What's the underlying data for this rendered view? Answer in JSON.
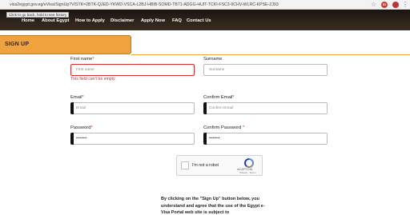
{
  "browser": {
    "url": "visa2egypt.gov.eg/eVisa/SignUp?VISTK=2BTK-QJED-YKWD-VSCA-L2BJ-HBIB-SOMD-TB71-ADGG-HUIT-TCKI-FSC3-9CHV-WLRC-KPSE-ZJ93",
    "tooltip": "Click to go back, hold to see history",
    "star_icon": "star-icon",
    "ext_badge": "ID"
  },
  "nav": {
    "items": [
      "Home",
      "About Egypt",
      "How to Apply",
      "Disclaimer",
      "Apply Now",
      "FAQ",
      "Contact Us"
    ]
  },
  "signup": {
    "title": "SIGN UP"
  },
  "form": {
    "first_name": {
      "label": "First name",
      "placeholder": "First name",
      "error": "This field can't be empty."
    },
    "surname": {
      "label": "Surname",
      "placeholder": "Surname"
    },
    "email": {
      "label": "Email",
      "placeholder": "Email"
    },
    "confirm_email": {
      "label": "Confirm Email",
      "placeholder": "Confirm Email"
    },
    "password": {
      "label": "Password",
      "value": "••••••••"
    },
    "confirm_password": {
      "label": "Confirm Password",
      "value": "••••••••"
    },
    "required_mark": "*"
  },
  "captcha": {
    "label": "I'm not a robot",
    "brand": "reCAPTCHA",
    "terms": "Privacy - Terms"
  },
  "agreement": {
    "text": "By clicking on the \"Sign Up\" button below, you understand and agree that the use of the Egypt e-Visa Portal web site is subject to"
  },
  "colors": {
    "accent": "#f0a23e",
    "error": "#d32f2f",
    "nav_bg": "#2a2119"
  }
}
